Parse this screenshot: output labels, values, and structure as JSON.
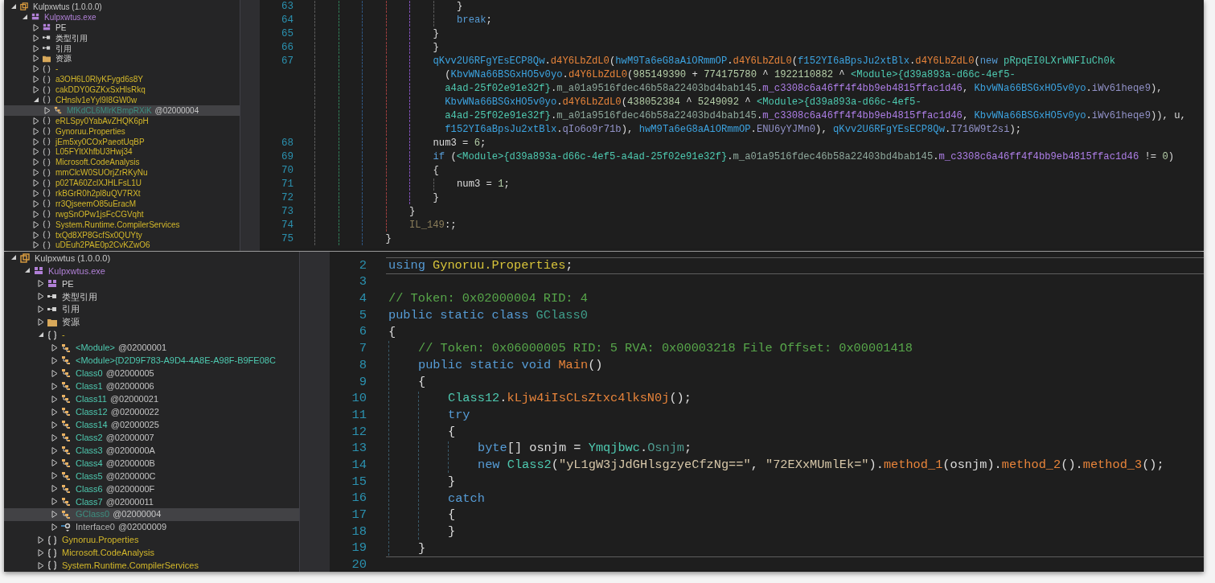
{
  "panels": [
    {
      "tree": [
        {
          "kind": "assembly",
          "name": "Kulpxwtus (1.0.0.0)",
          "expanded": true,
          "selected": false,
          "children": [
            {
              "kind": "module",
              "name": "Kulpxwtus.exe",
              "expanded": true,
              "selected": false,
              "children": [
                {
                  "kind": "pe",
                  "name": "PE",
                  "expanded": false,
                  "selected": false
                },
                {
                  "kind": "references",
                  "name": "类型引用",
                  "expanded": false,
                  "selected": false
                },
                {
                  "kind": "references",
                  "name": "引用",
                  "expanded": false,
                  "selected": false
                },
                {
                  "kind": "folder",
                  "name": "资源",
                  "expanded": false,
                  "selected": false
                },
                {
                  "kind": "namespace",
                  "name": "-",
                  "expanded": false,
                  "selected": false
                },
                {
                  "kind": "namespace",
                  "name": "a3OH6L0RlyKFygd6s8Y",
                  "expanded": false,
                  "selected": false
                },
                {
                  "kind": "namespace",
                  "name": "cakDDY0GZKxSxHlsRkq",
                  "expanded": false,
                  "selected": false
                },
                {
                  "kind": "namespace",
                  "name": "CHnslv1eYyl9I8GW0w",
                  "expanded": true,
                  "selected": false,
                  "children": [
                    {
                      "kind": "static-class",
                      "name": "MfKdCL6MlrKBmpRXiK",
                      "token": "@02000004",
                      "expanded": false,
                      "selected": true
                    }
                  ]
                },
                {
                  "kind": "namespace",
                  "name": "eRLSpy0YabAvZHQK6pH",
                  "expanded": false,
                  "selected": false
                },
                {
                  "kind": "namespace",
                  "name": "Gynoruu.Properties",
                  "expanded": false,
                  "selected": false
                },
                {
                  "kind": "namespace",
                  "name": "jEm5xy0COxPaeotUqBP",
                  "expanded": false,
                  "selected": false
                },
                {
                  "kind": "namespace",
                  "name": "L05FYltXhfbU3Hwj34",
                  "expanded": false,
                  "selected": false
                },
                {
                  "kind": "namespace",
                  "name": "Microsoft.CodeAnalysis",
                  "expanded": false,
                  "selected": false
                },
                {
                  "kind": "namespace",
                  "name": "mmClcW0SUOrjZrRKyNu",
                  "expanded": false,
                  "selected": false
                },
                {
                  "kind": "namespace",
                  "name": "p02TA60ZclXJHLFsL1U",
                  "expanded": false,
                  "selected": false
                },
                {
                  "kind": "namespace",
                  "name": "rkBGrR0h2pl8uQV7RXt",
                  "expanded": false,
                  "selected": false
                },
                {
                  "kind": "namespace",
                  "name": "rr3QjseemO85uEracM",
                  "expanded": false,
                  "selected": false
                },
                {
                  "kind": "namespace",
                  "name": "rwgSnOPw1jsFcCGVqht",
                  "expanded": false,
                  "selected": false
                },
                {
                  "kind": "namespace",
                  "name": "System.Runtime.CompilerServices",
                  "expanded": false,
                  "selected": false
                },
                {
                  "kind": "namespace",
                  "name": "txQd8XP8GcfSx0QUYty",
                  "expanded": false,
                  "selected": false
                },
                {
                  "kind": "namespace",
                  "name": "uDEuh2PAE0p2CvKZwO6",
                  "expanded": false,
                  "selected": false
                }
              ]
            }
          ]
        }
      ],
      "code": [
        {
          "children": [
            {
              "children": [
                {
                  "children": [
                    {
                      "number": "63",
                      "current": false,
                      "tokens": [
                        {
                          "kind": "plain",
                          "text": "}"
                        }
                      ]
                    },
                    {
                      "number": "64",
                      "current": false,
                      "tokens": [
                        {
                          "kind": "keyword",
                          "text": "break"
                        },
                        {
                          "kind": "plain",
                          "text": ";"
                        }
                      ]
                    }
                  ]
                },
                {
                  "number": "65",
                  "current": false,
                  "tokens": [
                    {
                      "kind": "plain",
                      "text": "}"
                    }
                  ]
                },
                {
                  "number": "66",
                  "current": false,
                  "tokens": [
                    {
                      "kind": "plain",
                      "text": "}"
                    }
                  ]
                },
                {
                  "number": "67",
                  "current": false,
                  "tokens": [
                    {
                      "kind": "static-type",
                      "text": "qKvv2U6RFgYEsECP8Qw"
                    },
                    {
                      "kind": "plain",
                      "text": "."
                    },
                    {
                      "kind": "method",
                      "text": "d4Y6LbZdL0"
                    },
                    {
                      "kind": "plain",
                      "text": "("
                    },
                    {
                      "kind": "static-type",
                      "text": "hwM9Ta6eG8aAiORmmOP"
                    },
                    {
                      "kind": "plain",
                      "text": "."
                    },
                    {
                      "kind": "method",
                      "text": "d4Y6LbZdL0"
                    },
                    {
                      "kind": "plain",
                      "text": "("
                    },
                    {
                      "kind": "static-type",
                      "text": "f152YI6aBpsJu2xtBlx"
                    },
                    {
                      "kind": "plain",
                      "text": "."
                    },
                    {
                      "kind": "method",
                      "text": "d4Y6LbZdL0"
                    },
                    {
                      "kind": "plain",
                      "text": "("
                    },
                    {
                      "kind": "keyword",
                      "text": "new "
                    },
                    {
                      "kind": "type",
                      "text": "pRpqEI0LXrWNFIuCh0k"
                    }
                  ],
                  "wrapped": [
                    [
                      {
                        "kind": "plain",
                        "text": "("
                      },
                      {
                        "kind": "static-type",
                        "text": "KbvWNa66BSGxHO5v0yo"
                      },
                      {
                        "kind": "plain",
                        "text": "."
                      },
                      {
                        "kind": "method",
                        "text": "d4Y6LbZdL0"
                      },
                      {
                        "kind": "plain",
                        "text": "("
                      },
                      {
                        "kind": "number",
                        "text": "985149390"
                      },
                      {
                        "kind": "plain",
                        "text": " + "
                      },
                      {
                        "kind": "number",
                        "text": "774175780"
                      },
                      {
                        "kind": "plain",
                        "text": " ^ "
                      },
                      {
                        "kind": "number",
                        "text": "1922110882"
                      },
                      {
                        "kind": "plain",
                        "text": " ^ "
                      },
                      {
                        "kind": "type",
                        "text": "<Module>{d39a893a-d66c-4ef5-"
                      }
                    ],
                    [
                      {
                        "kind": "type",
                        "text": "a4ad-25f02e91e32f}"
                      },
                      {
                        "kind": "plain",
                        "text": "."
                      },
                      {
                        "kind": "nested",
                        "text": "m_a01a9516fdec46b58a22403bd4bab145"
                      },
                      {
                        "kind": "plain",
                        "text": "."
                      },
                      {
                        "kind": "const-field",
                        "text": "m_c3308c6a46ff4f4bb9eb4815ffac1d46"
                      },
                      {
                        "kind": "plain",
                        "text": ", "
                      },
                      {
                        "kind": "static-type",
                        "text": "KbvWNa66BSGxHO5v0yo"
                      },
                      {
                        "kind": "plain",
                        "text": "."
                      },
                      {
                        "kind": "field",
                        "text": "iWv61heqe9"
                      },
                      {
                        "kind": "plain",
                        "text": "),"
                      }
                    ],
                    [
                      {
                        "kind": "static-type",
                        "text": "KbvWNa66BSGxHO5v0yo"
                      },
                      {
                        "kind": "plain",
                        "text": "."
                      },
                      {
                        "kind": "method",
                        "text": "d4Y6LbZdL0"
                      },
                      {
                        "kind": "plain",
                        "text": "("
                      },
                      {
                        "kind": "number",
                        "text": "438052384"
                      },
                      {
                        "kind": "plain",
                        "text": " ^ "
                      },
                      {
                        "kind": "number",
                        "text": "5249092"
                      },
                      {
                        "kind": "plain",
                        "text": " ^ "
                      },
                      {
                        "kind": "type",
                        "text": "<Module>{d39a893a-d66c-4ef5-"
                      }
                    ],
                    [
                      {
                        "kind": "type",
                        "text": "a4ad-25f02e91e32f}"
                      },
                      {
                        "kind": "plain",
                        "text": "."
                      },
                      {
                        "kind": "nested",
                        "text": "m_a01a9516fdec46b58a22403bd4bab145"
                      },
                      {
                        "kind": "plain",
                        "text": "."
                      },
                      {
                        "kind": "const-field",
                        "text": "m_c3308c6a46ff4f4bb9eb4815ffac1d46"
                      },
                      {
                        "kind": "plain",
                        "text": ", "
                      },
                      {
                        "kind": "static-type",
                        "text": "KbvWNa66BSGxHO5v0yo"
                      },
                      {
                        "kind": "plain",
                        "text": "."
                      },
                      {
                        "kind": "field",
                        "text": "iWv61heqe9"
                      },
                      {
                        "kind": "plain",
                        "text": ")), u,"
                      }
                    ],
                    [
                      {
                        "kind": "static-type",
                        "text": "f152YI6aBpsJu2xtBlx"
                      },
                      {
                        "kind": "plain",
                        "text": "."
                      },
                      {
                        "kind": "field",
                        "text": "qIo6o9r71b"
                      },
                      {
                        "kind": "plain",
                        "text": "), "
                      },
                      {
                        "kind": "static-type",
                        "text": "hwM9Ta6eG8aAiORmmOP"
                      },
                      {
                        "kind": "plain",
                        "text": "."
                      },
                      {
                        "kind": "field",
                        "text": "ENU6yYJMn0"
                      },
                      {
                        "kind": "plain",
                        "text": "), "
                      },
                      {
                        "kind": "static-type",
                        "text": "qKvv2U6RFgYEsECP8Qw"
                      },
                      {
                        "kind": "plain",
                        "text": "."
                      },
                      {
                        "kind": "field",
                        "text": "I716W9t2si"
                      },
                      {
                        "kind": "plain",
                        "text": ");"
                      }
                    ]
                  ]
                },
                {
                  "number": "68",
                  "current": false,
                  "tokens": [
                    {
                      "kind": "plain",
                      "text": "num3 = "
                    },
                    {
                      "kind": "number",
                      "text": "6"
                    },
                    {
                      "kind": "plain",
                      "text": ";"
                    }
                  ]
                },
                {
                  "number": "69",
                  "current": false,
                  "tokens": [
                    {
                      "kind": "keyword",
                      "text": "if"
                    },
                    {
                      "kind": "plain",
                      "text": " ("
                    },
                    {
                      "kind": "type",
                      "text": "<Module>{d39a893a-d66c-4ef5-a4ad-25f02e91e32f}"
                    },
                    {
                      "kind": "plain",
                      "text": "."
                    },
                    {
                      "kind": "nested",
                      "text": "m_a01a9516fdec46b58a22403bd4bab145"
                    },
                    {
                      "kind": "plain",
                      "text": "."
                    },
                    {
                      "kind": "const-field",
                      "text": "m_c3308c6a46ff4f4bb9eb4815ffac1d46"
                    },
                    {
                      "kind": "plain",
                      "text": " != "
                    },
                    {
                      "kind": "number",
                      "text": "0"
                    },
                    {
                      "kind": "plain",
                      "text": ")"
                    }
                  ]
                },
                {
                  "number": "70",
                  "current": false,
                  "tokens": [
                    {
                      "kind": "plain",
                      "text": "{"
                    }
                  ],
                  "children": [
                    {
                      "number": "71",
                      "current": false,
                      "tokens": [
                        {
                          "kind": "plain",
                          "text": "num3 = "
                        },
                        {
                          "kind": "number",
                          "text": "1"
                        },
                        {
                          "kind": "plain",
                          "text": ";"
                        }
                      ]
                    }
                  ]
                },
                {
                  "number": "72",
                  "current": false,
                  "tokens": [
                    {
                      "kind": "plain",
                      "text": "}"
                    }
                  ]
                }
              ]
            },
            {
              "number": "73",
              "current": false,
              "tokens": [
                {
                  "kind": "plain",
                  "text": "}"
                }
              ]
            },
            {
              "number": "74",
              "current": false,
              "tokens": [
                {
                  "kind": "label",
                  "text": "IL_149"
                },
                {
                  "kind": "plain",
                  "text": ":;"
                }
              ]
            }
          ]
        },
        {
          "number": "75",
          "current": false,
          "tokens": [
            {
              "kind": "plain",
              "text": "}"
            }
          ]
        }
      ]
    },
    {
      "tree": [
        {
          "kind": "assembly",
          "name": "Kulpxwtus (1.0.0.0)",
          "expanded": true,
          "selected": false,
          "children": [
            {
              "kind": "module",
              "name": "Kulpxwtus.exe",
              "expanded": true,
              "selected": false,
              "children": [
                {
                  "kind": "pe",
                  "name": "PE",
                  "expanded": false,
                  "selected": false
                },
                {
                  "kind": "references",
                  "name": "类型引用",
                  "expanded": false,
                  "selected": false
                },
                {
                  "kind": "references",
                  "name": "引用",
                  "expanded": false,
                  "selected": false
                },
                {
                  "kind": "folder",
                  "name": "资源",
                  "expanded": false,
                  "selected": false
                },
                {
                  "kind": "namespace",
                  "name": "-",
                  "expanded": true,
                  "selected": false,
                  "children": [
                    {
                      "kind": "class",
                      "name": "<Module>",
                      "token": "@02000001",
                      "expanded": false,
                      "selected": false
                    },
                    {
                      "kind": "class",
                      "name": "<Module>{D2D9F783-A9D4-4A8E-A98F-B9FE08C",
                      "expanded": false,
                      "selected": false
                    },
                    {
                      "kind": "class",
                      "name": "Class0",
                      "token": "@02000005",
                      "expanded": false,
                      "selected": false
                    },
                    {
                      "kind": "class",
                      "name": "Class1",
                      "token": "@02000006",
                      "expanded": false,
                      "selected": false
                    },
                    {
                      "kind": "class",
                      "name": "Class11",
                      "token": "@02000021",
                      "expanded": false,
                      "selected": false
                    },
                    {
                      "kind": "class",
                      "name": "Class12",
                      "token": "@02000022",
                      "expanded": false,
                      "selected": false
                    },
                    {
                      "kind": "class",
                      "name": "Class14",
                      "token": "@02000025",
                      "expanded": false,
                      "selected": false
                    },
                    {
                      "kind": "class",
                      "name": "Class2",
                      "token": "@02000007",
                      "expanded": false,
                      "selected": false
                    },
                    {
                      "kind": "class",
                      "name": "Class3",
                      "token": "@0200000A",
                      "expanded": false,
                      "selected": false
                    },
                    {
                      "kind": "class",
                      "name": "Class4",
                      "token": "@0200000B",
                      "expanded": false,
                      "selected": false
                    },
                    {
                      "kind": "class",
                      "name": "Class5",
                      "token": "@0200000C",
                      "expanded": false,
                      "selected": false
                    },
                    {
                      "kind": "class",
                      "name": "Class6",
                      "token": "@0200000F",
                      "expanded": false,
                      "selected": false
                    },
                    {
                      "kind": "class",
                      "name": "Class7",
                      "token": "@02000011",
                      "expanded": false,
                      "selected": false
                    },
                    {
                      "kind": "static-class",
                      "name": "GClass0",
                      "token": "@02000004",
                      "expanded": false,
                      "selected": true
                    },
                    {
                      "kind": "interface",
                      "name": "Interface0",
                      "token": "@02000009",
                      "expanded": false,
                      "selected": false
                    }
                  ]
                },
                {
                  "kind": "namespace",
                  "name": "Gynoruu.Properties",
                  "expanded": false,
                  "selected": false
                },
                {
                  "kind": "namespace",
                  "name": "Microsoft.CodeAnalysis",
                  "expanded": false,
                  "selected": false
                },
                {
                  "kind": "namespace",
                  "name": "System.Runtime.CompilerServices",
                  "expanded": false,
                  "selected": false
                }
              ]
            }
          ]
        }
      ],
      "code": [
        {
          "number": "2",
          "current": true,
          "tokens": [
            {
              "kind": "keyword",
              "text": "using "
            },
            {
              "kind": "namespace",
              "text": "Gynoruu.Properties"
            },
            {
              "kind": "plain",
              "text": ";"
            }
          ]
        },
        {
          "number": "3",
          "current": false
        },
        {
          "number": "4",
          "current": false,
          "tokens": [
            {
              "kind": "comment",
              "text": "// Token: 0x02000004 RID: 4"
            }
          ]
        },
        {
          "number": "5",
          "current": false,
          "tokens": [
            {
              "kind": "keyword",
              "text": "public static class "
            },
            {
              "kind": "static-class",
              "text": "GClass0"
            }
          ]
        },
        {
          "number": "6",
          "current": false,
          "tokens": [
            {
              "kind": "plain",
              "text": "{"
            }
          ],
          "children": [
            {
              "number": "7",
              "current": false,
              "tokens": [
                {
                  "kind": "comment",
                  "text": "// Token: 0x06000005 RID: 5 RVA: 0x00003218 File Offset: 0x00001418"
                }
              ]
            },
            {
              "number": "8",
              "current": false,
              "tokens": [
                {
                  "kind": "keyword",
                  "text": "public static void "
                },
                {
                  "kind": "method",
                  "text": "Main"
                },
                {
                  "kind": "plain",
                  "text": "()"
                }
              ]
            },
            {
              "number": "9",
              "current": false,
              "tokens": [
                {
                  "kind": "plain",
                  "text": "{"
                }
              ],
              "children": [
                {
                  "number": "10",
                  "current": false,
                  "tokens": [
                    {
                      "kind": "type",
                      "text": "Class12"
                    },
                    {
                      "kind": "plain",
                      "text": "."
                    },
                    {
                      "kind": "method",
                      "text": "kLjw4iIsCLsZtxc4lksN0j"
                    },
                    {
                      "kind": "plain",
                      "text": "();"
                    }
                  ]
                },
                {
                  "number": "11",
                  "current": false,
                  "tokens": [
                    {
                      "kind": "keyword",
                      "text": "try"
                    }
                  ]
                },
                {
                  "number": "12",
                  "current": false,
                  "tokens": [
                    {
                      "kind": "plain",
                      "text": "{"
                    }
                  ],
                  "children": [
                    {
                      "number": "13",
                      "current": false,
                      "tokens": [
                        {
                          "kind": "keyword",
                          "text": "byte"
                        },
                        {
                          "kind": "plain",
                          "text": "[] osnjm = "
                        },
                        {
                          "kind": "type",
                          "text": "Ymqjbwc"
                        },
                        {
                          "kind": "plain",
                          "text": "."
                        },
                        {
                          "kind": "property",
                          "text": "Osnjm"
                        },
                        {
                          "kind": "plain",
                          "text": ";"
                        }
                      ]
                    },
                    {
                      "number": "14",
                      "current": false,
                      "tokens": [
                        {
                          "kind": "keyword",
                          "text": "new "
                        },
                        {
                          "kind": "type",
                          "text": "Class2"
                        },
                        {
                          "kind": "plain",
                          "text": "("
                        },
                        {
                          "kind": "string",
                          "text": "\"yL1gW3jJdGHlsgzyeCfzNg==\""
                        },
                        {
                          "kind": "plain",
                          "text": ", "
                        },
                        {
                          "kind": "string",
                          "text": "\"72EXxMUmlEk=\""
                        },
                        {
                          "kind": "plain",
                          "text": ")."
                        },
                        {
                          "kind": "method",
                          "text": "method_1"
                        },
                        {
                          "kind": "plain",
                          "text": "(osnjm)."
                        },
                        {
                          "kind": "method",
                          "text": "method_2"
                        },
                        {
                          "kind": "plain",
                          "text": "()."
                        },
                        {
                          "kind": "method",
                          "text": "method_3"
                        },
                        {
                          "kind": "plain",
                          "text": "();"
                        }
                      ]
                    }
                  ]
                },
                {
                  "number": "15",
                  "current": false,
                  "tokens": [
                    {
                      "kind": "plain",
                      "text": "}"
                    }
                  ]
                },
                {
                  "number": "16",
                  "current": false,
                  "tokens": [
                    {
                      "kind": "keyword",
                      "text": "catch"
                    }
                  ]
                },
                {
                  "number": "17",
                  "current": false,
                  "tokens": [
                    {
                      "kind": "plain",
                      "text": "{"
                    }
                  ]
                },
                {
                  "number": "18",
                  "current": false,
                  "tokens": [
                    {
                      "kind": "plain",
                      "text": "}"
                    }
                  ]
                }
              ]
            },
            {
              "number": "19",
              "current": false,
              "tokens": [
                {
                  "kind": "plain",
                  "text": "}"
                }
              ]
            }
          ]
        },
        {
          "number": "20",
          "current": true
        }
      ]
    }
  ]
}
